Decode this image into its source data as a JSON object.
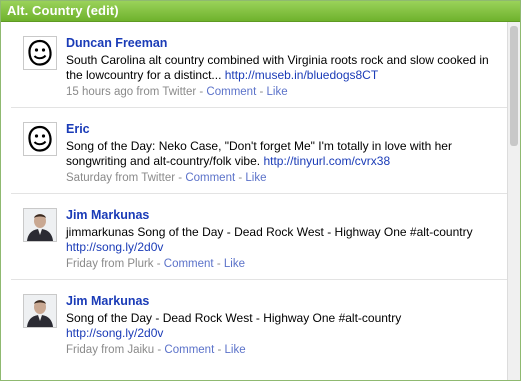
{
  "header": {
    "title": "Alt. Country (edit)"
  },
  "entries": [
    {
      "author": "Duncan Freeman",
      "avatar_icon": "smiley-face-icon",
      "text": "South Carolina alt country combined with Virginia roots rock and slow cooked in the lowcountry for a distinct... ",
      "link": "http://museb.in/bluedogs8CT",
      "time": "15 hours ago from Twitter",
      "sep1": " - ",
      "comment": "Comment",
      "sep2": " - ",
      "like": "Like"
    },
    {
      "author": "Eric",
      "avatar_icon": "smiley-face-icon",
      "text": "Song of the Day: Neko Case, \"Don't forget Me\" I'm totally in love with her songwriting and alt-country/folk vibe. ",
      "link": "http://tinyurl.com/cvrx38",
      "time": "Saturday from Twitter",
      "sep1": " - ",
      "comment": "Comment",
      "sep2": " - ",
      "like": "Like"
    },
    {
      "author": "Jim Markunas",
      "avatar_icon": "user-photo",
      "text": "jimmarkunas Song of the Day - Dead Rock West - Highway One #alt-country ",
      "link": "http://song.ly/2d0v",
      "time": "Friday from Plurk",
      "sep1": " - ",
      "comment": "Comment",
      "sep2": " - ",
      "like": "Like"
    },
    {
      "author": "Jim Markunas",
      "avatar_icon": "user-photo",
      "text": "Song of the Day - Dead Rock West - Highway One #alt-country ",
      "link": "http://song.ly/2d0v",
      "time": "Friday from Jaiku",
      "sep1": " - ",
      "comment": "Comment",
      "sep2": " - ",
      "like": "Like"
    }
  ],
  "colors": {
    "header": "#7cbd38",
    "link": "#1a3bb7",
    "meta": "#8a8a8a"
  }
}
